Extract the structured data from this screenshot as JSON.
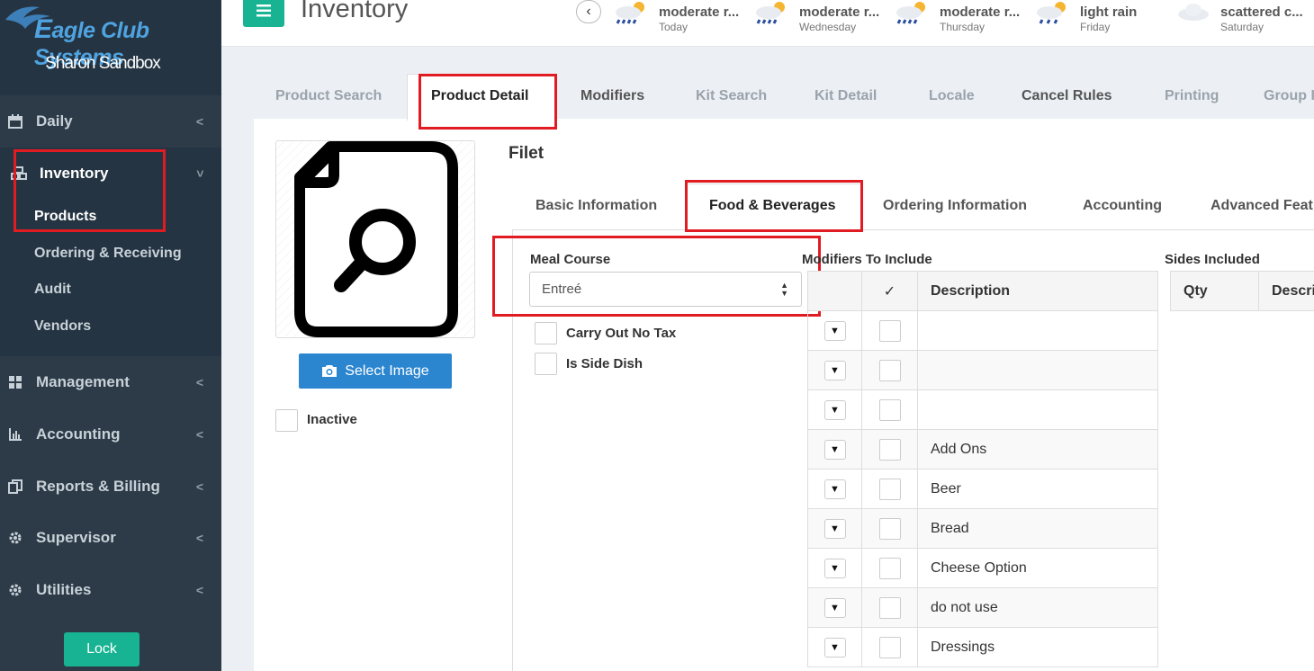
{
  "sidebar": {
    "brand": "Eagle Club Systems",
    "brand_first": "E",
    "brand_rest": "agle Club Systems",
    "club": "Sharon Sandbox",
    "items": [
      {
        "label": "Daily",
        "icon": "calendar-icon"
      },
      {
        "label": "Inventory",
        "icon": "cubes-icon"
      },
      {
        "label": "Management",
        "icon": "grid-icon"
      },
      {
        "label": "Accounting",
        "icon": "bar-chart-icon"
      },
      {
        "label": "Reports & Billing",
        "icon": "copy-icon"
      },
      {
        "label": "Supervisor",
        "icon": "gear-icon"
      },
      {
        "label": "Utilities",
        "icon": "gear-icon"
      }
    ],
    "inventory_sub": [
      "Products",
      "Ordering & Receiving",
      "Audit",
      "Vendors"
    ],
    "lock_label": "Lock"
  },
  "header": {
    "title": "Inventory",
    "weather": [
      {
        "condition": "moderate r...",
        "day": "Today",
        "icon": "rain-sun-icon"
      },
      {
        "condition": "moderate r...",
        "day": "Wednesday",
        "icon": "rain-sun-icon"
      },
      {
        "condition": "moderate r...",
        "day": "Thursday",
        "icon": "rain-sun-icon"
      },
      {
        "condition": "light rain",
        "day": "Friday",
        "icon": "rain-sun-icon"
      },
      {
        "condition": "scattered c...",
        "day": "Saturday",
        "icon": "cloud-icon"
      }
    ]
  },
  "tabs": [
    "Product Search",
    "Product Detail",
    "Modifiers",
    "Kit Search",
    "Kit Detail",
    "Locale",
    "Cancel Rules",
    "Printing",
    "Group I"
  ],
  "product": {
    "name": "Filet",
    "select_image_label": "Select Image",
    "inactive_label": "Inactive"
  },
  "subtabs": [
    "Basic Information",
    "Food & Beverages",
    "Ordering Information",
    "Accounting",
    "Advanced Feat"
  ],
  "food_bev": {
    "meal_course_label": "Meal Course",
    "meal_course_value": "Entreé",
    "carry_out_label": "Carry Out No Tax",
    "side_dish_label": "Is Side Dish",
    "modifiers_label": "Modifiers To Include",
    "modifiers_headers": [
      "",
      "✓",
      "Description"
    ],
    "modifiers_rows": [
      "",
      "",
      "",
      "Add Ons",
      "Beer",
      "Bread",
      "Cheese Option",
      "do not use",
      "Dressings"
    ],
    "sides_label": "Sides Included",
    "sides_headers": [
      "Qty",
      "Descri"
    ]
  },
  "colors": {
    "sidebar_bg": "#2c3b47",
    "accent_green": "#17b392",
    "button_blue": "#2b86cf",
    "highlight_red": "#e11b22"
  }
}
